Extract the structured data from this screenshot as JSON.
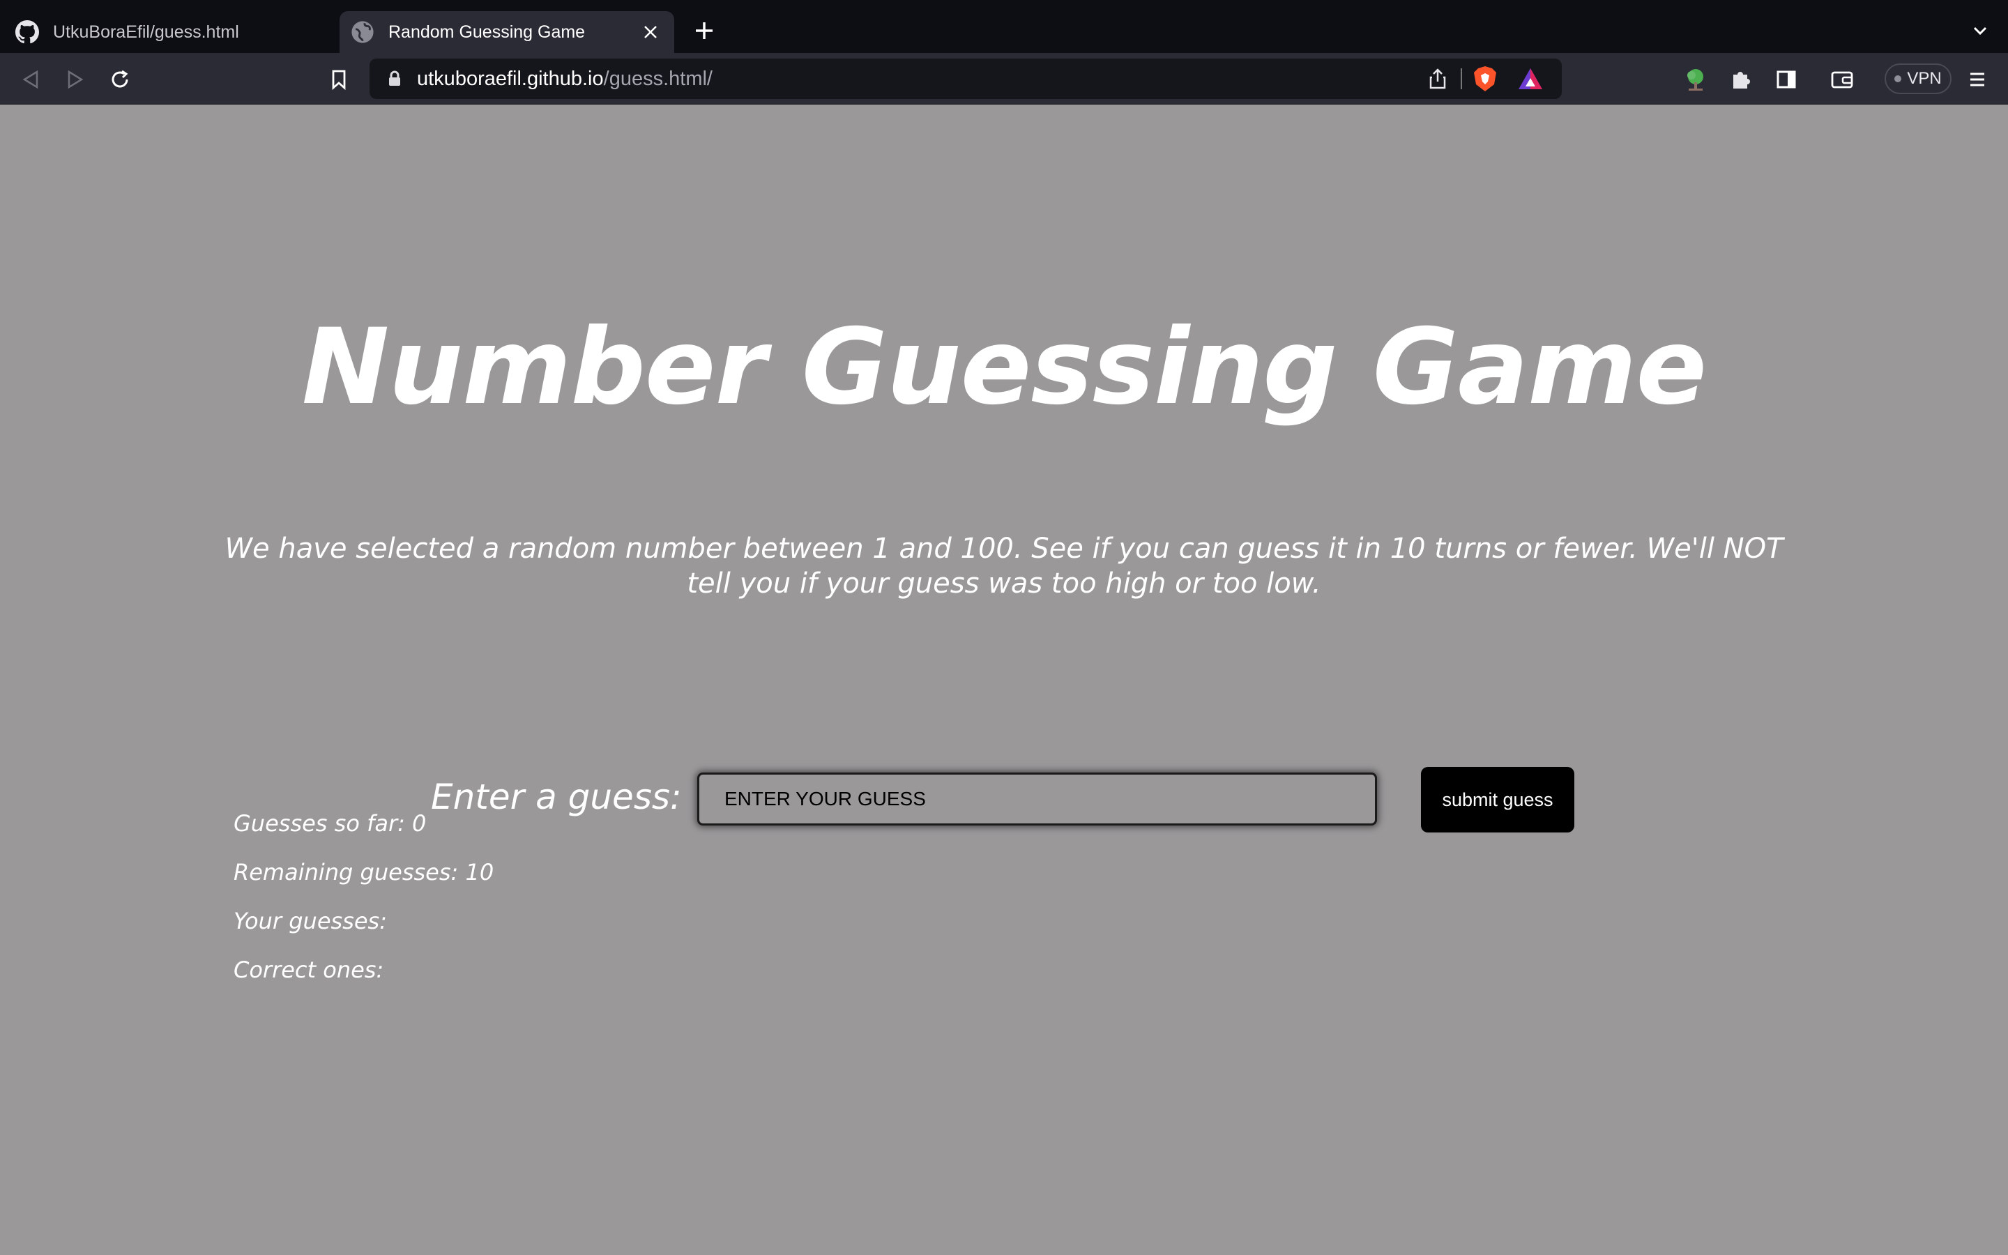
{
  "browser": {
    "tabs": [
      {
        "title": "UtkuBoraEfil/guess.html",
        "icon": "github-icon",
        "active": false
      },
      {
        "title": "Random Guessing Game",
        "icon": "globe-icon",
        "active": true
      }
    ],
    "url": {
      "host": "utkuboraefil.github.io",
      "path": "/guess.html/"
    },
    "vpn_label": "VPN"
  },
  "game": {
    "title": "Number Guessing Game",
    "intro": "We have selected a random number between 1 and 100. See if you can guess it in 10 turns or fewer. We'll NOT tell you if your guess was too high or too low.",
    "guess_label": "Enter a guess:",
    "guess_placeholder": "ENTER YOUR GUESS",
    "submit_label": "submit guess",
    "stats": {
      "guesses_so_far": "Guesses so far: 0",
      "remaining": "Remaining guesses: 10",
      "your_guesses": "Your guesses:",
      "correct_ones": "Correct ones:"
    }
  },
  "colors": {
    "page_background": "#9a9899",
    "tab_strip": "#0d0d14",
    "toolbar": "#2b2b35",
    "button": "#000000",
    "text": "#ffffff"
  }
}
